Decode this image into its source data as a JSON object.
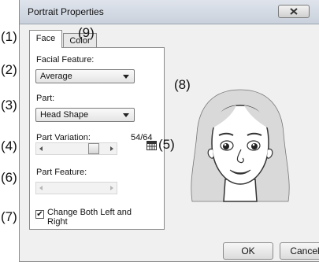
{
  "dialog": {
    "title": "Portrait Properties",
    "tabs": [
      "Face",
      "Color"
    ],
    "facial_feature_label": "Facial Feature:",
    "facial_feature_value": "Average",
    "part_label": "Part:",
    "part_value": "Head Shape",
    "part_variation_label": "Part Variation:",
    "part_variation_value": "54/64",
    "part_variation_level": 0.84,
    "part_feature_label": "Part Feature:",
    "checkbox_label_1": "Change Both Left and",
    "checkbox_label_2": "Right",
    "checkbox_checked": true,
    "ok_label": "OK",
    "cancel_label": "Cancel"
  },
  "annotations": [
    "(1)",
    "(2)",
    "(3)",
    "(4)",
    "(5)",
    "(6)",
    "(7)",
    "(8)",
    "(9)"
  ]
}
